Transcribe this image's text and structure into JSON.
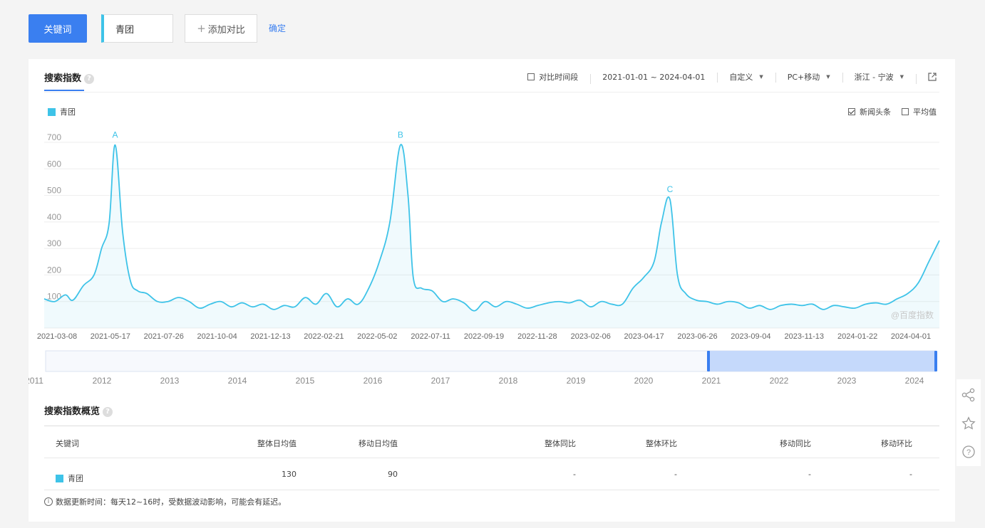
{
  "topbar": {
    "keyword_button": "关键词",
    "keyword_value": "青团",
    "add_compare": "添加对比",
    "confirm": "确定"
  },
  "tab": {
    "title": "搜索指数"
  },
  "filters": {
    "compare_period": "对比时间段",
    "date_range": "2021-01-01 ~ 2024-04-01",
    "custom": "自定义",
    "device": "PC+移动",
    "region": "浙江 - 宁波"
  },
  "legend": {
    "series_name": "青团"
  },
  "options": {
    "news": "新闻头条",
    "news_checked": true,
    "average": "平均值",
    "average_checked": false
  },
  "watermark": "@百度指数",
  "colors": {
    "series": "#3ec3e8",
    "accent": "#3a7ff0",
    "slider": "#c5d9fb"
  },
  "chart_data": {
    "type": "area",
    "ylim": [
      0,
      700
    ],
    "y_ticks": [
      "700",
      "600",
      "500",
      "400",
      "300",
      "200",
      "100"
    ],
    "x_ticks": [
      "2021-03-08",
      "2021-05-17",
      "2021-07-26",
      "2021-10-04",
      "2021-12-13",
      "2022-02-21",
      "2022-05-02",
      "2022-07-11",
      "2022-09-19",
      "2022-11-28",
      "2023-02-06",
      "2023-04-17",
      "2023-06-26",
      "2023-09-04",
      "2023-11-13",
      "2024-01-22",
      "2024-04-01"
    ],
    "x_range": [
      "2021-01-01",
      "2024-04-01"
    ],
    "annotations": [
      {
        "label": "A",
        "x": "2021-04-05",
        "y": 690
      },
      {
        "label": "B",
        "x": "2022-04-18",
        "y": 690
      },
      {
        "label": "C",
        "x": "2023-04-10",
        "y": 485
      }
    ],
    "series": [
      {
        "name": "青团",
        "points": [
          [
            "2021-01-01",
            110
          ],
          [
            "2021-01-15",
            100
          ],
          [
            "2021-01-29",
            125
          ],
          [
            "2021-02-08",
            105
          ],
          [
            "2021-02-22",
            160
          ],
          [
            "2021-03-08",
            200
          ],
          [
            "2021-03-18",
            300
          ],
          [
            "2021-03-28",
            395
          ],
          [
            "2021-04-05",
            690
          ],
          [
            "2021-04-15",
            360
          ],
          [
            "2021-04-25",
            180
          ],
          [
            "2021-05-05",
            140
          ],
          [
            "2021-05-17",
            130
          ],
          [
            "2021-05-31",
            100
          ],
          [
            "2021-06-14",
            100
          ],
          [
            "2021-06-28",
            115
          ],
          [
            "2021-07-12",
            100
          ],
          [
            "2021-07-26",
            75
          ],
          [
            "2021-08-09",
            90
          ],
          [
            "2021-08-23",
            100
          ],
          [
            "2021-09-06",
            80
          ],
          [
            "2021-09-20",
            95
          ],
          [
            "2021-10-04",
            80
          ],
          [
            "2021-10-18",
            90
          ],
          [
            "2021-11-01",
            70
          ],
          [
            "2021-11-15",
            85
          ],
          [
            "2021-11-29",
            80
          ],
          [
            "2021-12-13",
            115
          ],
          [
            "2021-12-27",
            90
          ],
          [
            "2022-01-10",
            130
          ],
          [
            "2022-01-24",
            80
          ],
          [
            "2022-02-07",
            110
          ],
          [
            "2022-02-21",
            90
          ],
          [
            "2022-03-07",
            150
          ],
          [
            "2022-03-21",
            250
          ],
          [
            "2022-04-04",
            400
          ],
          [
            "2022-04-18",
            690
          ],
          [
            "2022-04-28",
            500
          ],
          [
            "2022-05-05",
            190
          ],
          [
            "2022-05-16",
            150
          ],
          [
            "2022-05-30",
            140
          ],
          [
            "2022-06-13",
            100
          ],
          [
            "2022-06-27",
            110
          ],
          [
            "2022-07-11",
            95
          ],
          [
            "2022-07-25",
            65
          ],
          [
            "2022-08-08",
            100
          ],
          [
            "2022-08-22",
            80
          ],
          [
            "2022-09-05",
            100
          ],
          [
            "2022-09-19",
            90
          ],
          [
            "2022-10-03",
            75
          ],
          [
            "2022-10-17",
            85
          ],
          [
            "2022-10-31",
            95
          ],
          [
            "2022-11-14",
            100
          ],
          [
            "2022-11-28",
            95
          ],
          [
            "2022-12-12",
            105
          ],
          [
            "2022-12-26",
            80
          ],
          [
            "2023-01-09",
            100
          ],
          [
            "2023-01-23",
            90
          ],
          [
            "2023-02-06",
            90
          ],
          [
            "2023-02-20",
            150
          ],
          [
            "2023-03-06",
            190
          ],
          [
            "2023-03-20",
            250
          ],
          [
            "2023-03-30",
            400
          ],
          [
            "2023-04-10",
            485
          ],
          [
            "2023-04-20",
            200
          ],
          [
            "2023-05-01",
            130
          ],
          [
            "2023-05-15",
            105
          ],
          [
            "2023-05-29",
            100
          ],
          [
            "2023-06-12",
            90
          ],
          [
            "2023-06-26",
            100
          ],
          [
            "2023-07-10",
            95
          ],
          [
            "2023-07-24",
            75
          ],
          [
            "2023-08-07",
            85
          ],
          [
            "2023-08-21",
            70
          ],
          [
            "2023-09-04",
            85
          ],
          [
            "2023-09-18",
            90
          ],
          [
            "2023-10-02",
            85
          ],
          [
            "2023-10-16",
            90
          ],
          [
            "2023-10-30",
            70
          ],
          [
            "2023-11-13",
            85
          ],
          [
            "2023-11-27",
            80
          ],
          [
            "2023-12-11",
            75
          ],
          [
            "2023-12-25",
            90
          ],
          [
            "2024-01-08",
            95
          ],
          [
            "2024-01-22",
            90
          ],
          [
            "2024-02-05",
            110
          ],
          [
            "2024-02-19",
            130
          ],
          [
            "2024-03-04",
            170
          ],
          [
            "2024-03-18",
            250
          ],
          [
            "2024-04-01",
            330
          ]
        ]
      }
    ]
  },
  "timeline": {
    "years": [
      "2011",
      "2012",
      "2013",
      "2014",
      "2015",
      "2016",
      "2017",
      "2018",
      "2019",
      "2020",
      "2021",
      "2022",
      "2023",
      "2024"
    ],
    "selected_range": [
      "2021-01-01",
      "2024-04-01"
    ]
  },
  "overview": {
    "title": "搜索指数概览",
    "headers": [
      "关键词",
      "整体日均值",
      "移动日均值",
      "整体同比",
      "整体环比",
      "移动同比",
      "移动环比"
    ],
    "row": {
      "keyword": "青团",
      "overall_avg": "130",
      "mobile_avg": "90",
      "overall_yoy": "-",
      "overall_mom": "-",
      "mobile_yoy": "-",
      "mobile_mom": "-"
    }
  },
  "note": "数据更新时间：每天12~16时，受数据波动影响，可能会有延迟。",
  "side_tools": [
    "share-icon",
    "star-icon",
    "help-icon"
  ]
}
